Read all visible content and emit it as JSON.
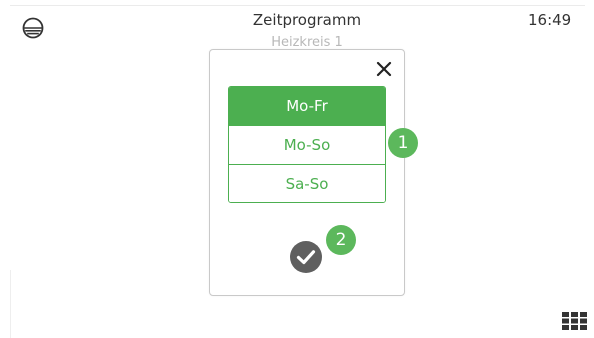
{
  "header": {
    "icon": "lamp-shade-icon",
    "title": "Zeitprogramm",
    "subtitle": "Heizkreis 1",
    "time": "16:49"
  },
  "dialog": {
    "close_icon": "close-icon",
    "options": [
      {
        "label": "Mo-Fr",
        "selected": true
      },
      {
        "label": "Mo-So",
        "selected": false
      },
      {
        "label": "Sa-So",
        "selected": false
      }
    ],
    "confirm_icon": "checkmark-circle-icon"
  },
  "callouts": {
    "one": "1",
    "two": "2"
  },
  "footer": {
    "menu_icon": "grid-menu-icon"
  },
  "colors": {
    "accent": "#4caf50",
    "callout": "#5cb85c",
    "confirm": "#5f5f5f",
    "subtitle": "#b8b8b8"
  }
}
